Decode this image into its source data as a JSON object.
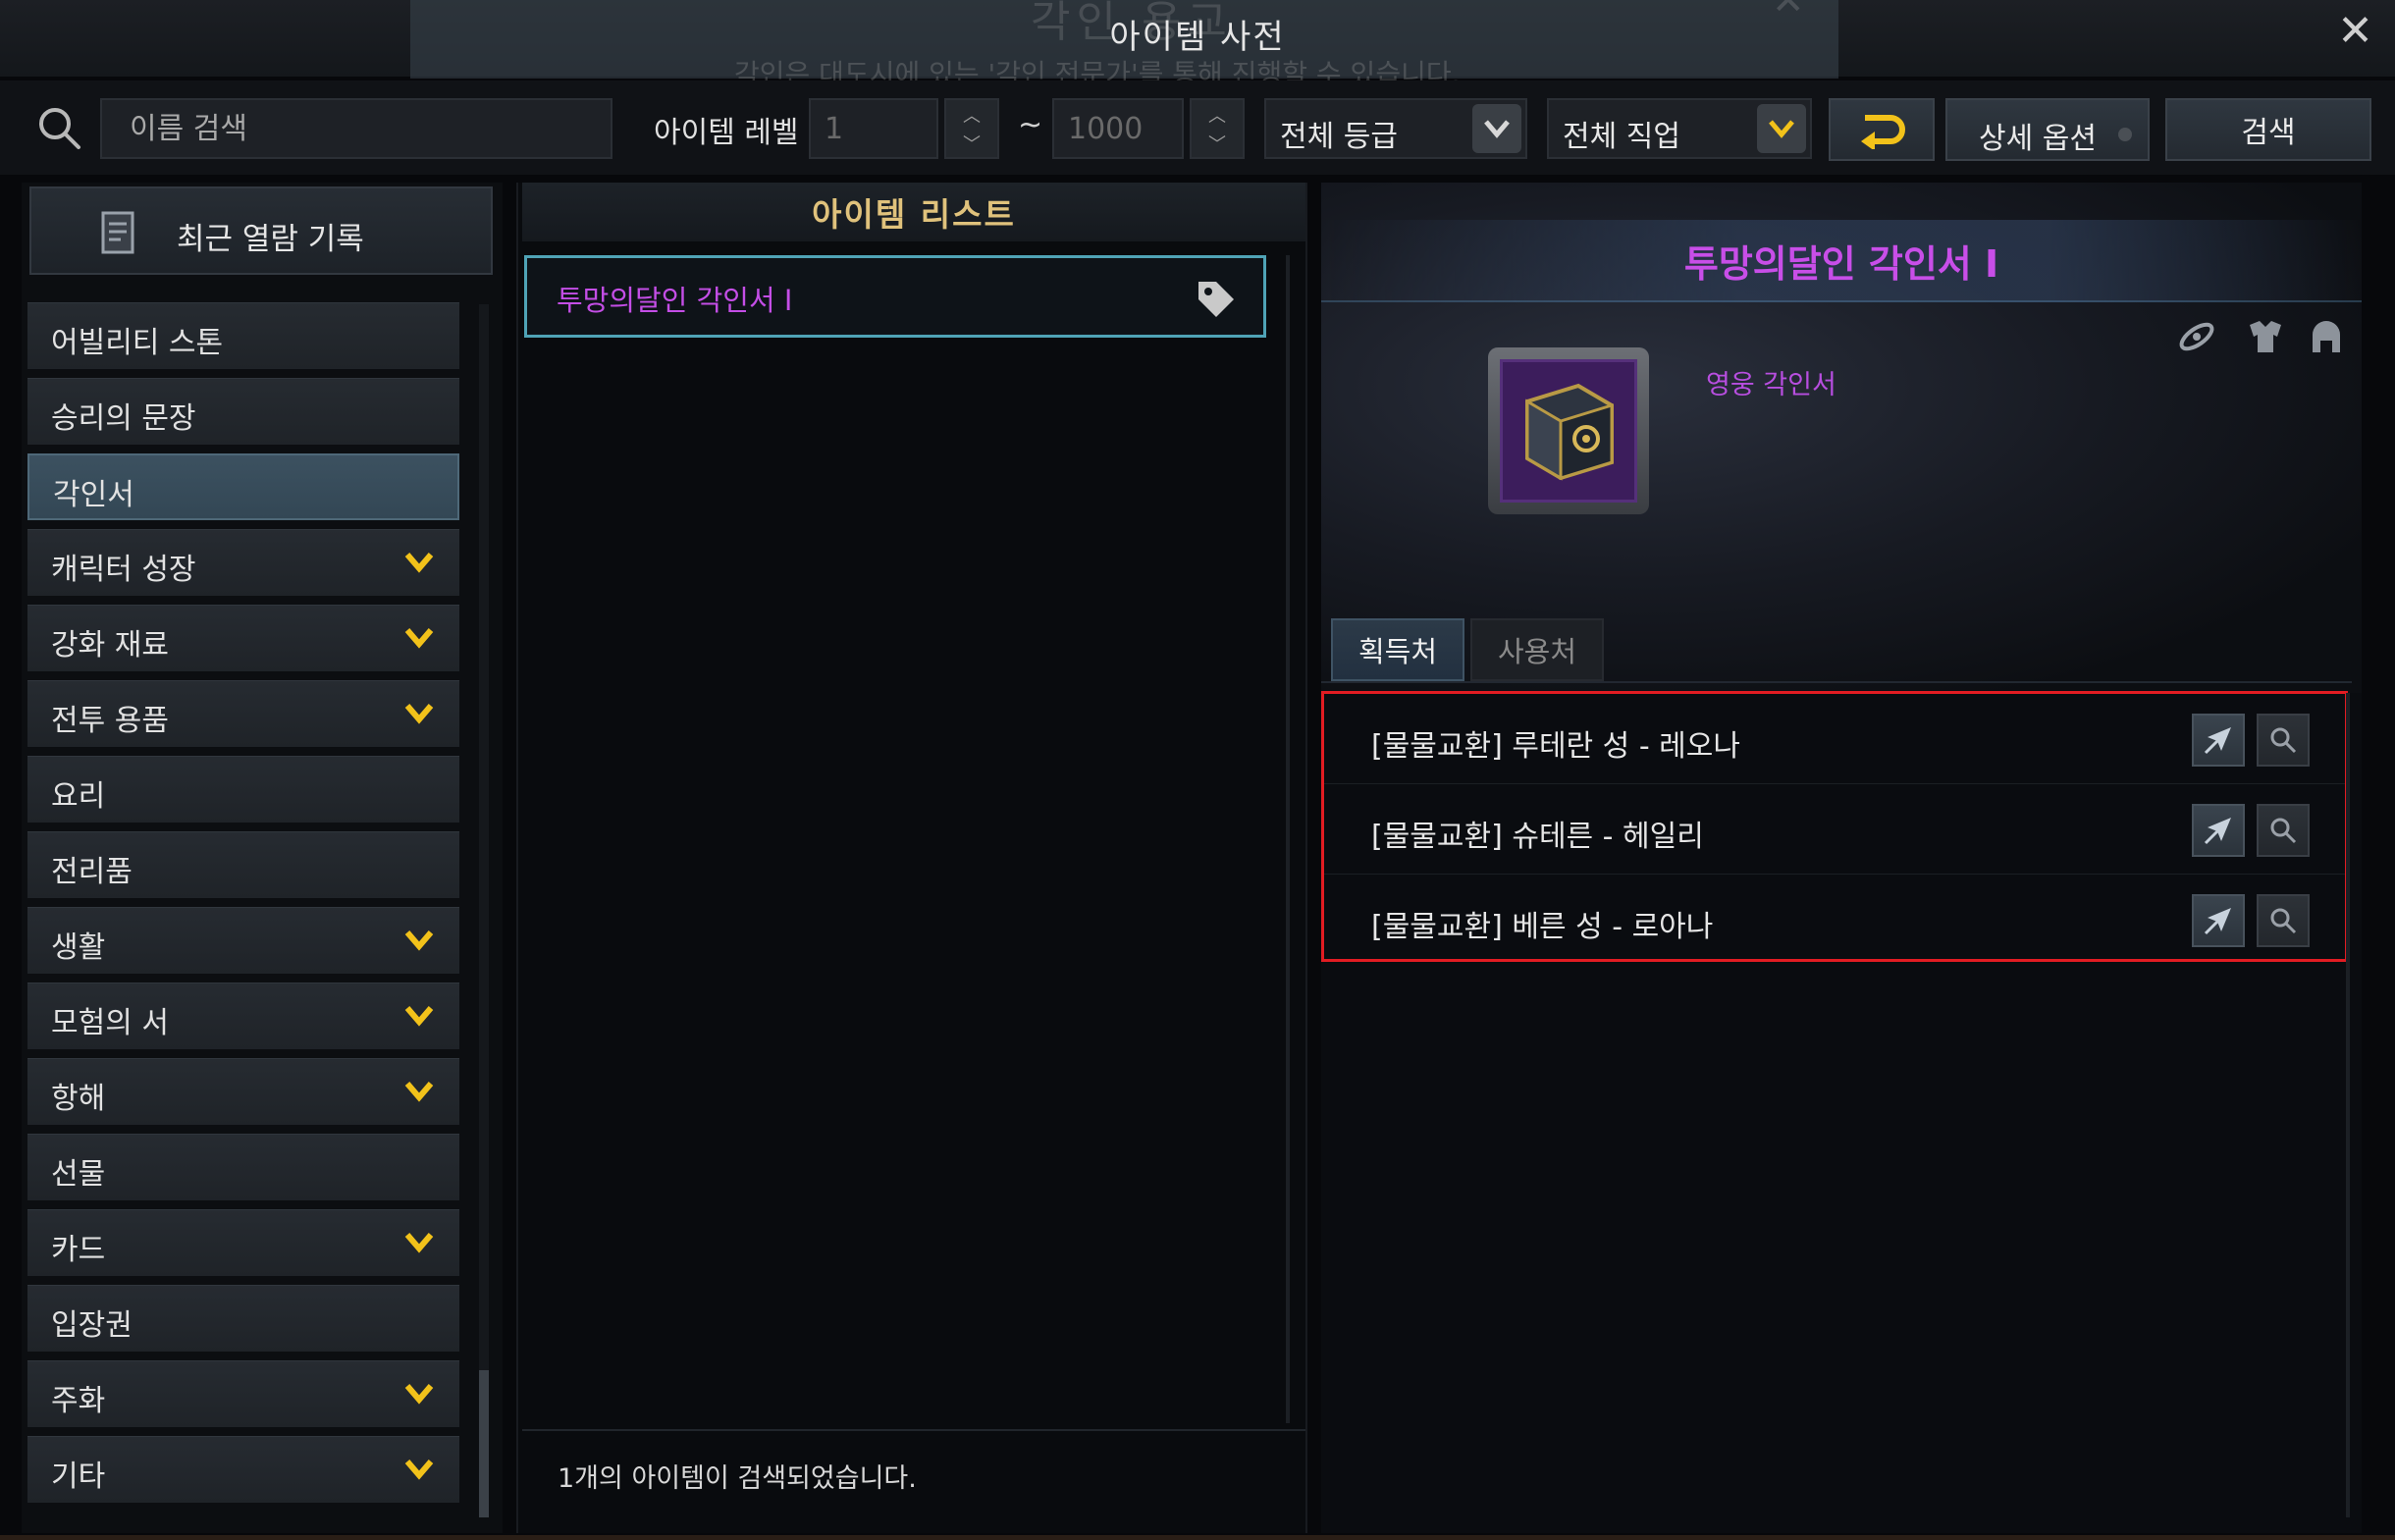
{
  "window": {
    "title": "아이템 사전",
    "background_title": "각인 용교",
    "background_subtitle": "각인은 대도시에 있는 '각인 전문가'를 통해 진행할 수 있습니다."
  },
  "toolbar": {
    "search_placeholder": "이름 검색",
    "level_label": "아이템 레벨",
    "level_min": "1",
    "level_sep": "~",
    "level_max": "1000",
    "grade_select": "전체 등급",
    "class_select": "전체 직업",
    "detail_options": "상세 옵션",
    "search_button": "검색"
  },
  "sidebar": {
    "recent": "최근 열람 기록",
    "categories": [
      {
        "label": "어빌리티 스톤",
        "expandable": false
      },
      {
        "label": "승리의 문장",
        "expandable": false
      },
      {
        "label": "각인서",
        "expandable": false,
        "selected": true
      },
      {
        "label": "캐릭터 성장",
        "expandable": true
      },
      {
        "label": "강화 재료",
        "expandable": true
      },
      {
        "label": "전투 용품",
        "expandable": true
      },
      {
        "label": "요리",
        "expandable": false
      },
      {
        "label": "전리품",
        "expandable": false
      },
      {
        "label": "생활",
        "expandable": true
      },
      {
        "label": "모험의 서",
        "expandable": true
      },
      {
        "label": "항해",
        "expandable": true
      },
      {
        "label": "선물",
        "expandable": false
      },
      {
        "label": "카드",
        "expandable": true
      },
      {
        "label": "입장권",
        "expandable": false
      },
      {
        "label": "주화",
        "expandable": true
      },
      {
        "label": "기타",
        "expandable": true
      }
    ]
  },
  "item_list": {
    "header": "아이템 리스트",
    "items": [
      {
        "name": "투망의달인 각인서 I"
      }
    ],
    "result_text": "1개의 아이템이 검색되었습니다."
  },
  "detail": {
    "name": "투망의달인 각인서 I",
    "grade": "영웅 각인서",
    "tabs": [
      "획득처",
      "사용처"
    ],
    "active_tab": 0,
    "sources": [
      "[물물교환] 루테란 성 - 레오나",
      "[물물교환] 슈테른 - 헤일리",
      "[물물교환] 베른 성 - 로아나"
    ]
  },
  "colors": {
    "hero_purple": "#c84ee8",
    "gold": "#e0c27c",
    "accent_yellow": "#f2c21a",
    "highlight_red": "#e21c22",
    "selected_cyan": "#4fa3b6"
  }
}
